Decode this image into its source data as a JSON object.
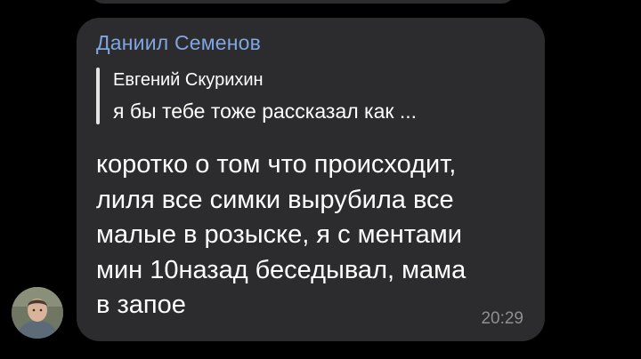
{
  "message": {
    "sender_name": "Даниил Семенов",
    "reply": {
      "author": "Евгений Скурихин",
      "preview": "я бы тебе тоже рассказал как ..."
    },
    "lines": [
      "коротко о том что происходит,",
      "лиля все симки вырубила все",
      "малые в розыске, я с ментами",
      "мин 10назад беседывал, мама",
      "в запое"
    ],
    "time": "20:29"
  },
  "colors": {
    "background": "#000000",
    "bubble": "#2c2c2e",
    "sender_name": "#7fa6e0",
    "timestamp": "#8e8e93",
    "reply_bar": "#e4e4e4"
  }
}
